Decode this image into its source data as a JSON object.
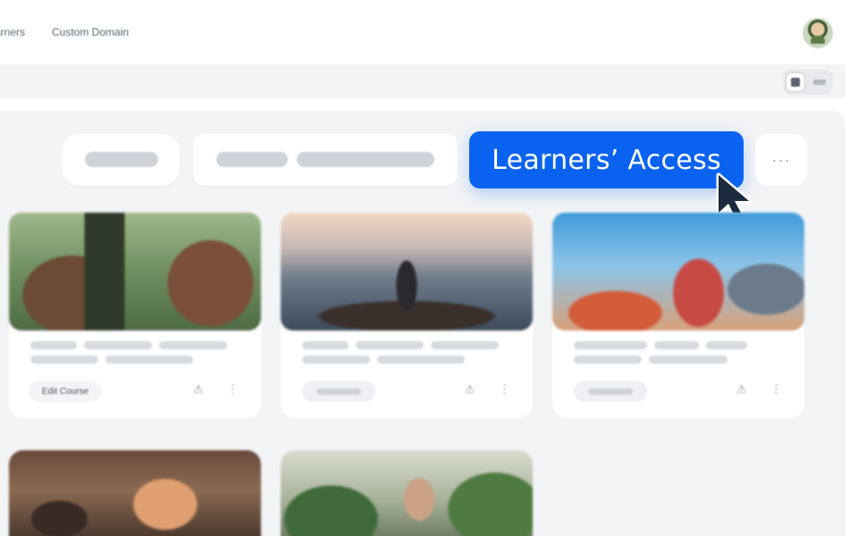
{
  "topbar": {
    "nav": [
      {
        "label": "arners"
      },
      {
        "label": "Custom Domain"
      }
    ],
    "avatar_icon": "user-avatar"
  },
  "toolbar": {
    "view_toggle": {
      "options": [
        "grid-view-icon",
        "list-view-icon"
      ],
      "selected": "grid-view-icon"
    }
  },
  "actions": {
    "cta_label": "Learners’ Access",
    "more_label": "···"
  },
  "courses": [
    {
      "chip": "Edit Course",
      "image_icon": "yoga-class-photo"
    },
    {
      "chip": "",
      "image_icon": "meditation-photo"
    },
    {
      "chip": "",
      "image_icon": "adventure-photo"
    },
    {
      "chip": "",
      "image_icon": "classroom-photo"
    },
    {
      "chip": "",
      "image_icon": "plants-studio-photo"
    }
  ],
  "icons": {
    "card_user_icon": "⚠",
    "card_menu_icon": "⋮"
  },
  "colors": {
    "accent": "#0a63f0",
    "panel": "#f3f4f6"
  }
}
